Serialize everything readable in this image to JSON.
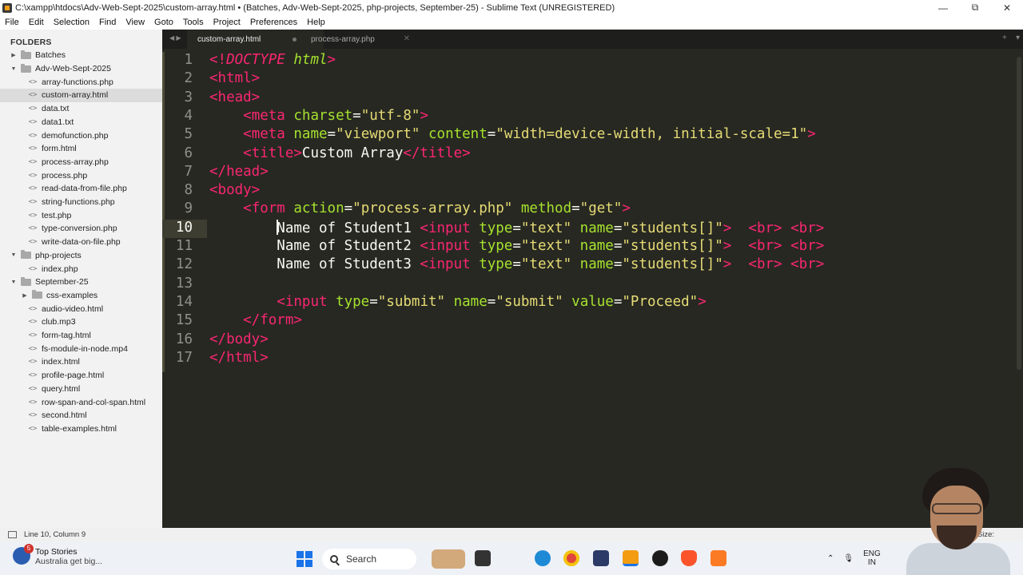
{
  "window": {
    "title": "C:\\xampp\\htdocs\\Adv-Web-Sept-2025\\custom-array.html • (Batches, Adv-Web-Sept-2025, php-projects, September-25) - Sublime Text (UNREGISTERED)",
    "minimize": "—",
    "maximize": "⧉",
    "close": "✕"
  },
  "menu": [
    "File",
    "Edit",
    "Selection",
    "Find",
    "View",
    "Goto",
    "Tools",
    "Project",
    "Preferences",
    "Help"
  ],
  "sidebar": {
    "title": "FOLDERS",
    "items": [
      {
        "label": "Batches",
        "type": "folder",
        "expanded": false,
        "depth": 0
      },
      {
        "label": "Adv-Web-Sept-2025",
        "type": "folder",
        "expanded": true,
        "depth": 0
      },
      {
        "label": "array-functions.php",
        "type": "file",
        "depth": 1
      },
      {
        "label": "custom-array.html",
        "type": "file",
        "depth": 1,
        "selected": true
      },
      {
        "label": "data.txt",
        "type": "file",
        "depth": 1
      },
      {
        "label": "data1.txt",
        "type": "file",
        "depth": 1
      },
      {
        "label": "demofunction.php",
        "type": "file",
        "depth": 1
      },
      {
        "label": "form.html",
        "type": "file",
        "depth": 1
      },
      {
        "label": "process-array.php",
        "type": "file",
        "depth": 1
      },
      {
        "label": "process.php",
        "type": "file",
        "depth": 1
      },
      {
        "label": "read-data-from-file.php",
        "type": "file",
        "depth": 1
      },
      {
        "label": "string-functions.php",
        "type": "file",
        "depth": 1
      },
      {
        "label": "test.php",
        "type": "file",
        "depth": 1
      },
      {
        "label": "type-conversion.php",
        "type": "file",
        "depth": 1
      },
      {
        "label": "write-data-on-file.php",
        "type": "file",
        "depth": 1
      },
      {
        "label": "php-projects",
        "type": "folder",
        "expanded": true,
        "depth": 0
      },
      {
        "label": "index.php",
        "type": "file",
        "depth": 1
      },
      {
        "label": "September-25",
        "type": "folder",
        "expanded": true,
        "depth": 0
      },
      {
        "label": "css-examples",
        "type": "folder",
        "expanded": false,
        "depth": 1
      },
      {
        "label": "audio-video.html",
        "type": "file",
        "depth": 1
      },
      {
        "label": "club.mp3",
        "type": "file",
        "depth": 1
      },
      {
        "label": "form-tag.html",
        "type": "file",
        "depth": 1
      },
      {
        "label": "fs-module-in-node.mp4",
        "type": "file",
        "depth": 1
      },
      {
        "label": "index.html",
        "type": "file",
        "depth": 1
      },
      {
        "label": "profile-page.html",
        "type": "file",
        "depth": 1
      },
      {
        "label": "query.html",
        "type": "file",
        "depth": 1
      },
      {
        "label": "row-span-and-col-span.html",
        "type": "file",
        "depth": 1
      },
      {
        "label": "second.html",
        "type": "file",
        "depth": 1
      },
      {
        "label": "table-examples.html",
        "type": "file",
        "depth": 1
      }
    ]
  },
  "tabs": [
    {
      "label": "custom-array.html",
      "active": true,
      "modified": true
    },
    {
      "label": "process-array.php",
      "active": false,
      "modified": false
    }
  ],
  "code": {
    "current_line": 10,
    "lines": [
      {
        "n": "1",
        "tokens": [
          [
            "t",
            "<!"
          ],
          [
            "t i",
            "DOCTYPE"
          ],
          [
            "p",
            " "
          ],
          [
            "a i",
            "html"
          ],
          [
            "t",
            ">"
          ]
        ]
      },
      {
        "n": "2",
        "tokens": [
          [
            "t",
            "<html>"
          ]
        ]
      },
      {
        "n": "3",
        "tokens": [
          [
            "t",
            "<head>"
          ]
        ]
      },
      {
        "n": "4",
        "tokens": [
          [
            "p",
            "    "
          ],
          [
            "t",
            "<meta"
          ],
          [
            "p",
            " "
          ],
          [
            "a",
            "charset"
          ],
          [
            "p",
            "="
          ],
          [
            "s",
            "\"utf-8\""
          ],
          [
            "t",
            ">"
          ]
        ]
      },
      {
        "n": "5",
        "tokens": [
          [
            "p",
            "    "
          ],
          [
            "t",
            "<meta"
          ],
          [
            "p",
            " "
          ],
          [
            "a",
            "name"
          ],
          [
            "p",
            "="
          ],
          [
            "s",
            "\"viewport\""
          ],
          [
            "p",
            " "
          ],
          [
            "a",
            "content"
          ],
          [
            "p",
            "="
          ],
          [
            "s",
            "\"width=device-width, initial-scale=1\""
          ],
          [
            "t",
            ">"
          ]
        ]
      },
      {
        "n": "6",
        "tokens": [
          [
            "p",
            "    "
          ],
          [
            "t",
            "<title>"
          ],
          [
            "p",
            "Custom Array"
          ],
          [
            "t",
            "</title>"
          ]
        ]
      },
      {
        "n": "7",
        "tokens": [
          [
            "t",
            "</head>"
          ]
        ]
      },
      {
        "n": "8",
        "tokens": [
          [
            "t",
            "<body>"
          ]
        ]
      },
      {
        "n": "9",
        "tokens": [
          [
            "p",
            "    "
          ],
          [
            "t",
            "<form"
          ],
          [
            "p",
            " "
          ],
          [
            "a",
            "action"
          ],
          [
            "p",
            "="
          ],
          [
            "s",
            "\"process-array.php\""
          ],
          [
            "p",
            " "
          ],
          [
            "a",
            "method"
          ],
          [
            "p",
            "="
          ],
          [
            "s",
            "\"get\""
          ],
          [
            "t",
            ">"
          ]
        ]
      },
      {
        "n": "10",
        "tokens": [
          [
            "p",
            "        "
          ],
          [
            "cursor",
            ""
          ],
          [
            "p",
            "Name of Student1 "
          ],
          [
            "t",
            "<input"
          ],
          [
            "p",
            " "
          ],
          [
            "a",
            "type"
          ],
          [
            "p",
            "="
          ],
          [
            "s",
            "\"text\""
          ],
          [
            "p",
            " "
          ],
          [
            "a",
            "name"
          ],
          [
            "p",
            "="
          ],
          [
            "s",
            "\"students[]\""
          ],
          [
            "t",
            ">"
          ],
          [
            "p",
            "  "
          ],
          [
            "t",
            "<br>"
          ],
          [
            "p",
            " "
          ],
          [
            "t",
            "<br>"
          ]
        ]
      },
      {
        "n": "11",
        "tokens": [
          [
            "p",
            "        "
          ],
          [
            "p",
            "Name of Student2 "
          ],
          [
            "t",
            "<input"
          ],
          [
            "p",
            " "
          ],
          [
            "a",
            "type"
          ],
          [
            "p",
            "="
          ],
          [
            "s",
            "\"text\""
          ],
          [
            "p",
            " "
          ],
          [
            "a",
            "name"
          ],
          [
            "p",
            "="
          ],
          [
            "s",
            "\"students[]\""
          ],
          [
            "t",
            ">"
          ],
          [
            "p",
            "  "
          ],
          [
            "t",
            "<br>"
          ],
          [
            "p",
            " "
          ],
          [
            "t",
            "<br>"
          ]
        ]
      },
      {
        "n": "12",
        "tokens": [
          [
            "p",
            "        "
          ],
          [
            "p",
            "Name of Student3 "
          ],
          [
            "t",
            "<input"
          ],
          [
            "p",
            " "
          ],
          [
            "a",
            "type"
          ],
          [
            "p",
            "="
          ],
          [
            "s",
            "\"text\""
          ],
          [
            "p",
            " "
          ],
          [
            "a",
            "name"
          ],
          [
            "p",
            "="
          ],
          [
            "s",
            "\"students[]\""
          ],
          [
            "t",
            ">"
          ],
          [
            "p",
            "  "
          ],
          [
            "t",
            "<br>"
          ],
          [
            "p",
            " "
          ],
          [
            "t",
            "<br>"
          ]
        ]
      },
      {
        "n": "13",
        "tokens": []
      },
      {
        "n": "14",
        "tokens": [
          [
            "p",
            "        "
          ],
          [
            "t",
            "<input"
          ],
          [
            "p",
            " "
          ],
          [
            "a",
            "type"
          ],
          [
            "p",
            "="
          ],
          [
            "s",
            "\"submit\""
          ],
          [
            "p",
            " "
          ],
          [
            "a",
            "name"
          ],
          [
            "p",
            "="
          ],
          [
            "s",
            "\"submit\""
          ],
          [
            "p",
            " "
          ],
          [
            "a",
            "value"
          ],
          [
            "p",
            "="
          ],
          [
            "s",
            "\"Proceed\""
          ],
          [
            "t",
            ">"
          ]
        ]
      },
      {
        "n": "15",
        "tokens": [
          [
            "p",
            "    "
          ],
          [
            "t",
            "</form>"
          ]
        ]
      },
      {
        "n": "16",
        "tokens": [
          [
            "t",
            "</body>"
          ]
        ]
      },
      {
        "n": "17",
        "tokens": [
          [
            "t",
            "</html>"
          ]
        ]
      }
    ]
  },
  "status": {
    "position": "Line 10, Column 9",
    "right": "Tab Size:"
  },
  "taskbar": {
    "news_title": "Top Stories",
    "news_sub": "Australia get big...",
    "news_count": "5",
    "search_label": "Search",
    "lang_top": "ENG",
    "lang_bottom": "IN"
  },
  "colors": {
    "editor_bg": "#272822",
    "tag": "#f92672",
    "attr": "#a6e22e",
    "string": "#e6db74",
    "text": "#f8f8f2",
    "sidebar_bg": "#f2f2f2"
  }
}
